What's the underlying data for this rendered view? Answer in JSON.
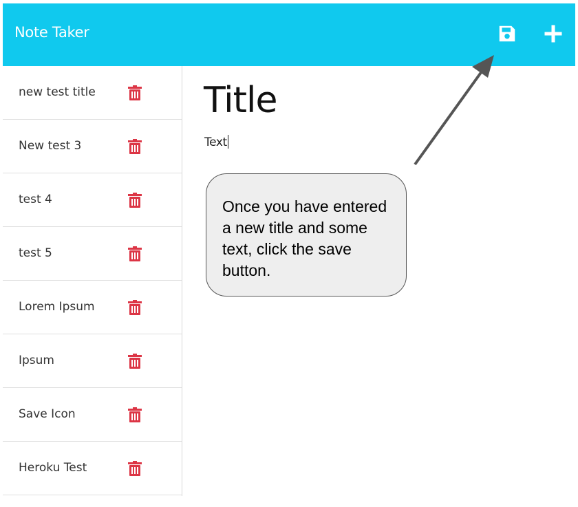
{
  "app": {
    "title": "Note Taker"
  },
  "header": {
    "save_icon": "save-floppy-icon",
    "new_icon": "plus-icon"
  },
  "notes": [
    {
      "title": "new test title"
    },
    {
      "title": "New test 3"
    },
    {
      "title": "test 4"
    },
    {
      "title": "test 5"
    },
    {
      "title": "Lorem Ipsum"
    },
    {
      "title": "Ipsum"
    },
    {
      "title": "Save Icon"
    },
    {
      "title": "Heroku Test"
    }
  ],
  "editor": {
    "title_placeholder": "Title",
    "text_placeholder": "Text"
  },
  "annotation": {
    "text": "Once you have entered a new title and some text, click the save button."
  },
  "colors": {
    "navbar": "#10c9ee",
    "trash": "#dc3545",
    "arrow": "#555555",
    "callout_bg": "#eeeeee"
  }
}
